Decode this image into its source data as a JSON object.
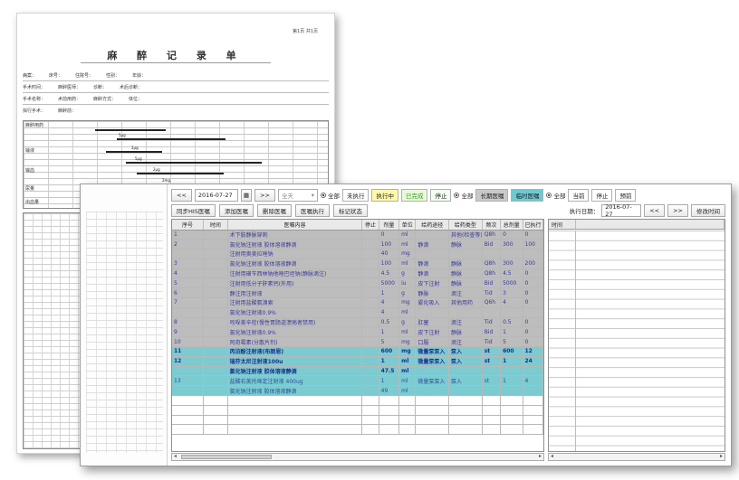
{
  "paper": {
    "page_no": "第1页 共1页",
    "title": "麻 醉 记 录 单",
    "fields": {
      "row1": [
        "病案：",
        "床号：",
        "住院号：",
        "性别：",
        "年龄："
      ],
      "row2": [
        "手术时间：",
        "麻醉医师：",
        "诊断：",
        "术后诊断："
      ],
      "row3": [
        "手术名称：",
        "术前用药：",
        "麻醉方式：",
        "体位："
      ],
      "row4": [
        "拟行手术：",
        "麻醉前："
      ]
    },
    "drug_tags": [
      "5μg",
      "2μg",
      "5μg",
      "2μg",
      "2mg"
    ],
    "section_labels": [
      "麻醉用药",
      "输液",
      "输血",
      "尿量",
      "出血量"
    ]
  },
  "window": {
    "toolbar1": {
      "prev": "<<",
      "date": "2016-07-27",
      "next": ">>",
      "filter_select": "全天",
      "radio_all": "全部",
      "chip_unexec": "未执行",
      "chip_exec": "执行中",
      "chip_done": "已完成",
      "chip_stop": "停止",
      "radio_all2": "全部",
      "chip_long": "长期医嘱",
      "chip_temp": "临时医嘱",
      "radio_all3": "全部",
      "chip_cur": "当前",
      "chip_stopped": "停止",
      "chip_preset": "预前"
    },
    "toolbar2": {
      "btn_sync": "同步HIS医嘱",
      "btn_add": "添加医嘱",
      "btn_delete": "删除医嘱",
      "btn_exec": "医嘱执行",
      "btn_mark": "标记状态"
    },
    "toolbar2_right": {
      "exec_date_label": "执行日期：",
      "exec_date": "2016-07-27",
      "prev": "<<",
      "next": ">>",
      "btn_modify_time": "修改时间"
    },
    "columns": [
      "序号",
      "时间",
      "医嘱内容",
      "停止",
      "剂量",
      "单位",
      "给药途径",
      "给药类型",
      "频次",
      "总剂量",
      "已执行"
    ],
    "orders": [
      {
        "no": "1",
        "time": "",
        "content": "术下肢静脉穿刺",
        "stop": "",
        "dose": "0",
        "unit": "ml",
        "route": "",
        "type": "其他(检查等)",
        "freq": "Q8h",
        "total": "0",
        "done": "0",
        "style": "gray"
      },
      {
        "no": "2",
        "time": "",
        "content": "氯化钠注射液 胶体溶液静滴",
        "stop": "",
        "dose": "100",
        "unit": "ml",
        "route": "静滴",
        "type": "静脉",
        "freq": "Bid",
        "total": "300",
        "done": "100",
        "style": "gray"
      },
      {
        "no": "",
        "time": "",
        "content": "注射用奥美拉唑钠",
        "stop": "",
        "dose": "40",
        "unit": "mg",
        "route": "",
        "type": "",
        "freq": "",
        "total": "",
        "done": "",
        "style": "gray"
      },
      {
        "no": "3",
        "time": "",
        "content": "氯化钠注射液 胶体溶液静滴",
        "stop": "",
        "dose": "100",
        "unit": "ml",
        "route": "静滴",
        "type": "静脉",
        "freq": "Q8h",
        "total": "300",
        "done": "200",
        "style": "gray"
      },
      {
        "no": "4",
        "time": "",
        "content": "注射用磺苄西林钠他唑巴坦钠(静脉滴注)",
        "stop": "",
        "dose": "4.5",
        "unit": "g",
        "route": "静滴",
        "type": "静脉",
        "freq": "Q8h",
        "total": "4.5",
        "done": "0",
        "style": "gray"
      },
      {
        "no": "5",
        "time": "",
        "content": "注射用低分子肝素钙(外用)",
        "stop": "",
        "dose": "5000",
        "unit": "iu",
        "route": "皮下注射",
        "type": "静脉",
        "freq": "Bid",
        "total": "5000",
        "done": "0",
        "style": "gray"
      },
      {
        "no": "6",
        "time": "",
        "content": "静注用注射液",
        "stop": "",
        "dose": "1",
        "unit": "g",
        "route": "静脉",
        "type": "滴注",
        "freq": "Tid",
        "total": "3",
        "done": "0",
        "style": "gray"
      },
      {
        "no": "7",
        "time": "",
        "content": "注射用盐酸氨溴索",
        "stop": "",
        "dose": "4",
        "unit": "mg",
        "route": "雾化吸入",
        "type": "其他用药",
        "freq": "Q6h",
        "total": "4",
        "done": "0",
        "style": "gray"
      },
      {
        "no": "",
        "time": "",
        "content": "氯化钠注射液0.9%",
        "stop": "",
        "dose": "4",
        "unit": "ml",
        "route": "",
        "type": "",
        "freq": "",
        "total": "",
        "done": "",
        "style": "gray"
      },
      {
        "no": "8",
        "time": "",
        "content": "吲哚美辛栓(慢性胃肠道溃疡者禁用)",
        "stop": "",
        "dose": "0.5",
        "unit": "g",
        "route": "肛塞",
        "type": "滴注",
        "freq": "Tid",
        "total": "0.5",
        "done": "0",
        "style": "gray"
      },
      {
        "no": "9",
        "time": "",
        "content": "氯化钠注射液0.9%",
        "stop": "",
        "dose": "1",
        "unit": "ml",
        "route": "皮下注射",
        "type": "静脉",
        "freq": "Bid",
        "total": "1",
        "done": "0",
        "style": "gray"
      },
      {
        "no": "10",
        "time": "",
        "content": "阿奇霉素(分散片剂)",
        "stop": "",
        "dose": "5",
        "unit": "mg",
        "route": "口服",
        "type": "滴注",
        "freq": "Tid",
        "total": "5",
        "done": "0",
        "style": "gray"
      },
      {
        "no": "11",
        "time": "",
        "content": "丙泊酚注射液(布朗恩)",
        "stop": "",
        "dose": "600",
        "unit": "mg",
        "route": "微量泵泵入",
        "type": "泵入",
        "freq": "st",
        "total": "600",
        "done": "12",
        "style": "teal"
      },
      {
        "no": "12",
        "time": "",
        "content": "瑞芬太尼注射液100u",
        "stop": "",
        "dose": "1",
        "unit": "ml",
        "route": "微量泵泵入",
        "type": "泵入",
        "freq": "st",
        "total": "1",
        "done": "24",
        "style": "teal"
      },
      {
        "no": "",
        "time": "",
        "content": "氯化钠注射液 胶体溶液静滴",
        "stop": "",
        "dose": "47.5",
        "unit": "ml",
        "route": "",
        "type": "",
        "freq": "",
        "total": "",
        "done": "",
        "style": "teal"
      },
      {
        "no": "13",
        "time": "",
        "content": "盐酸右美托咪定注射液 400ug",
        "stop": "",
        "dose": "1",
        "unit": "ml",
        "route": "微量泵泵入",
        "type": "泵入",
        "freq": "st",
        "total": "1",
        "done": "4",
        "style": "teal-light"
      },
      {
        "no": "",
        "time": "",
        "content": "氯化钠注射液 胶体溶液静滴",
        "stop": "",
        "dose": "49",
        "unit": "ml",
        "route": "",
        "type": "",
        "freq": "",
        "total": "",
        "done": "",
        "style": "teal-light"
      }
    ],
    "right_panel": {
      "columns": [
        "时间",
        ""
      ]
    }
  }
}
